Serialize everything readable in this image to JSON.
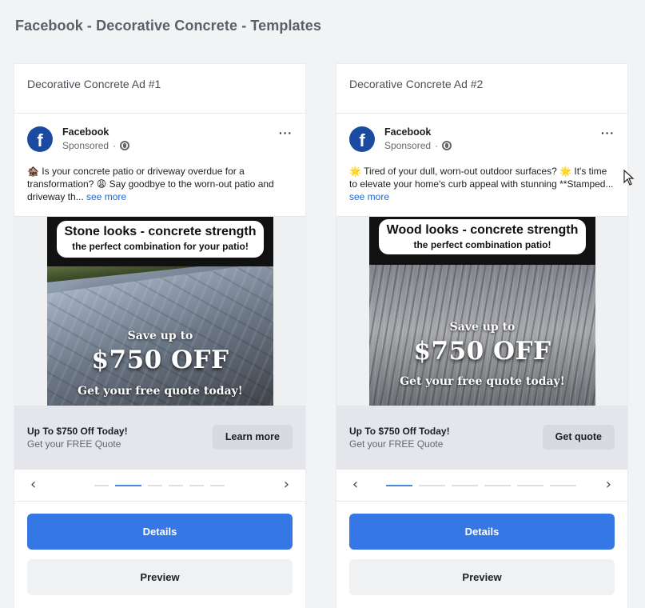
{
  "page_title": "Facebook - Decorative Concrete - Templates",
  "colors": {
    "primary_button": "#3578e5",
    "link": "#1e66d0",
    "fb_logo": "#1a4ba0"
  },
  "ads": [
    {
      "header": "Decorative Concrete Ad #1",
      "page_name": "Facebook",
      "sponsored": "Sponsored",
      "separator": "·",
      "emoji_1": "🏚️",
      "text_1": " Is your concrete patio or driveway overdue for a transformation? ",
      "emoji_2": "😩",
      "text_2": " Say goodbye to the worn-out patio and driveway th...",
      "see_more": "see more",
      "image": {
        "title": "Stone looks - concrete strength",
        "subtitle": "the perfect combination for your patio!",
        "save": "Save up to",
        "price": "$750 OFF",
        "quote": "Get your free quote today!"
      },
      "cta_headline": "Up To $750 Off Today!",
      "cta_sub": "Get your FREE Quote",
      "cta_button": "Learn more",
      "details": "Details",
      "preview": "Preview",
      "active_slide": 1
    },
    {
      "header": "Decorative Concrete Ad #2",
      "page_name": "Facebook",
      "sponsored": "Sponsored",
      "separator": "·",
      "emoji_1": "🌟",
      "text_1": " Tired of your dull, worn-out outdoor surfaces? ",
      "emoji_2": "🌟",
      "text_2": " It's time to elevate your home's curb appeal with stunning **Stamped...",
      "see_more": "see more",
      "image": {
        "title": "Wood looks - concrete strength",
        "subtitle": "the perfect combination patio!",
        "save": "Save up to",
        "price": "$750 OFF",
        "quote": "Get your free quote today!"
      },
      "cta_headline": "Up To $750 Off Today!",
      "cta_sub": "Get your FREE Quote",
      "cta_button": "Get quote",
      "details": "Details",
      "preview": "Preview",
      "active_slide": 0
    }
  ],
  "icons": {
    "fb_logo": "f",
    "more": "···",
    "arrow_left": "‹",
    "arrow_right": "›"
  }
}
